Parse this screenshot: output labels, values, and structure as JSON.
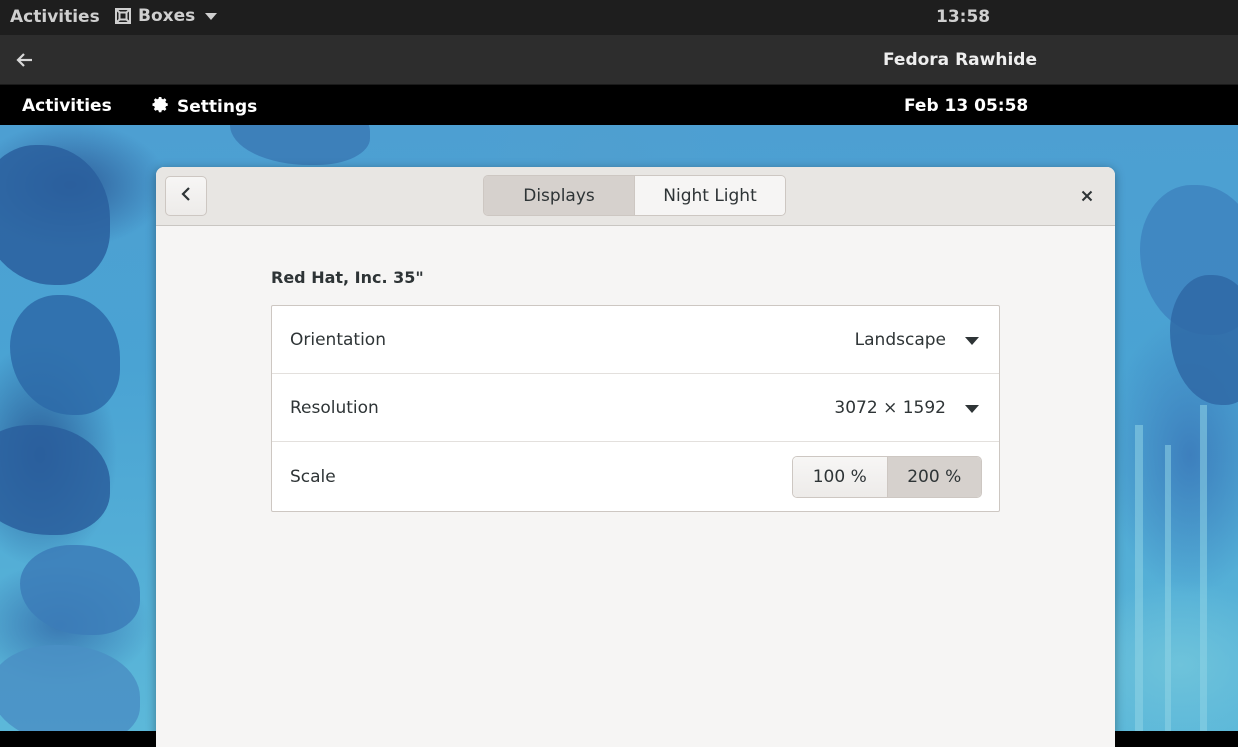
{
  "host_topbar": {
    "activities": "Activities",
    "app_name": "Boxes",
    "clock": "13:58"
  },
  "boxes_header": {
    "title": "Fedora Rawhide"
  },
  "guest_topbar": {
    "activities": "Activities",
    "app_name": "Settings",
    "clock": "Feb 13  05:58"
  },
  "window": {
    "tabs": [
      {
        "label": "Displays",
        "active": true
      },
      {
        "label": "Night Light",
        "active": false
      }
    ],
    "monitor_name": "Red Hat, Inc. 35\"",
    "orientation": {
      "label": "Orientation",
      "value": "Landscape"
    },
    "resolution": {
      "label": "Resolution",
      "value": "3072 × 1592"
    },
    "scale": {
      "label": "Scale",
      "options": [
        "100 %",
        "200 %"
      ],
      "selected": "200 %"
    }
  },
  "colors": {
    "header_bg": "#e8e6e3",
    "active_tab": "#d6d1cd",
    "text": "#2e3436"
  }
}
